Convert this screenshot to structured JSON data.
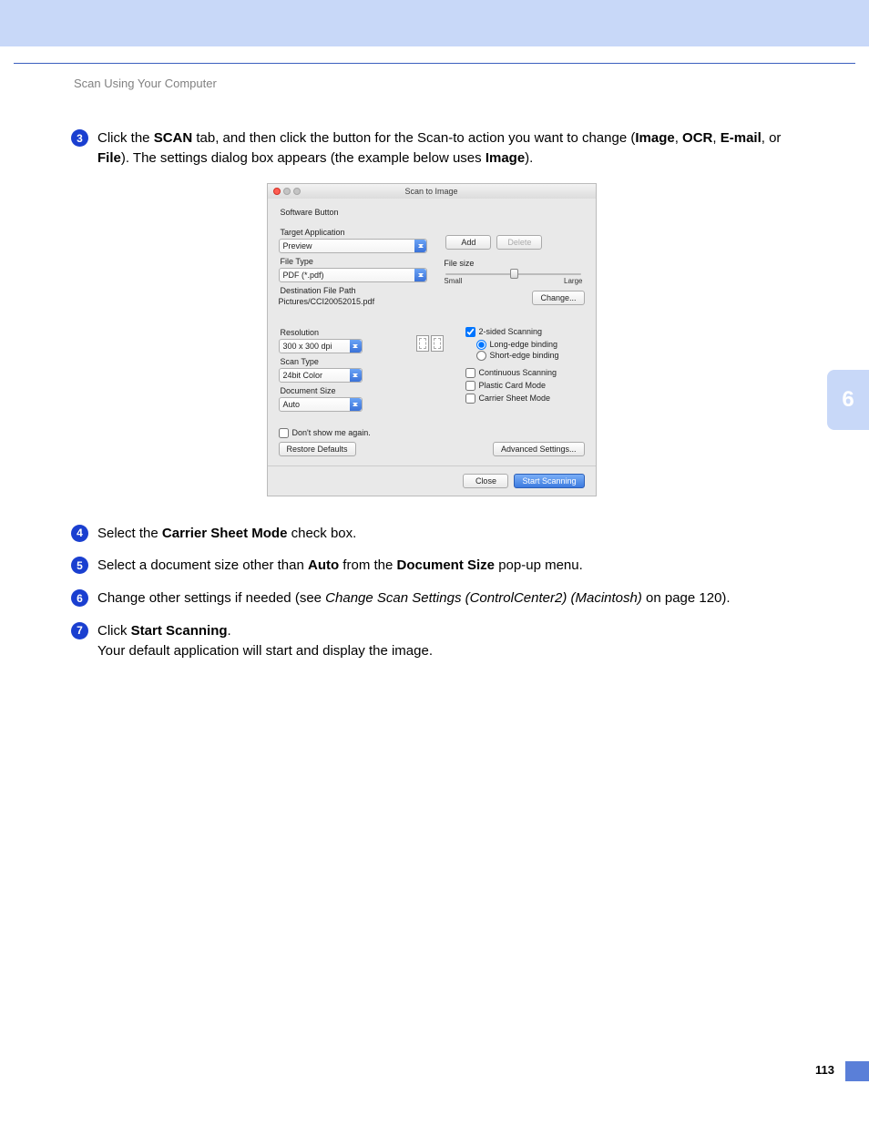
{
  "header": {
    "title": "Scan Using Your Computer"
  },
  "steps": {
    "s3": {
      "num": "3",
      "p1a": "Click the ",
      "scan": "SCAN",
      "p1b": " tab, and then click the button for the Scan-to action you want to change (",
      "image": "Image",
      "c1": ", ",
      "ocr": "OCR",
      "c2": ", ",
      "email": "E-mail",
      "c3": ", or ",
      "file": "File",
      "p1c": "). The settings dialog box appears (the example below uses ",
      "image2": "Image",
      "p1d": ")."
    },
    "s4": {
      "num": "4",
      "a": "Select the ",
      "b": "Carrier Sheet Mode",
      "c": " check box."
    },
    "s5": {
      "num": "5",
      "a": "Select a document size other than ",
      "b": "Auto",
      "c": " from the ",
      "d": "Document Size",
      "e": " pop-up menu."
    },
    "s6": {
      "num": "6",
      "a": "Change other settings if needed (see ",
      "b": "Change Scan Settings (ControlCenter2) (Macintosh)",
      "c": " on page 120)."
    },
    "s7": {
      "num": "7",
      "a": "Click ",
      "b": "Start Scanning",
      "c": ".",
      "d": "Your default application will start and display the image."
    }
  },
  "dlg": {
    "title": "Scan to Image",
    "tab": "Software Button",
    "targetApp": {
      "lbl": "Target Application",
      "val": "Preview"
    },
    "addBtn": "Add",
    "delBtn": "Delete",
    "fileType": {
      "lbl": "File Type",
      "val": "PDF (*.pdf)"
    },
    "fileSize": {
      "lbl": "File size",
      "small": "Small",
      "large": "Large"
    },
    "destPath": {
      "lbl": "Destination File Path",
      "val": "Pictures/CCI20052015.pdf"
    },
    "changeBtn": "Change...",
    "resolution": {
      "lbl": "Resolution",
      "val": "300 x 300 dpi"
    },
    "scanType": {
      "lbl": "Scan Type",
      "val": "24bit Color"
    },
    "docSize": {
      "lbl": "Document Size",
      "val": "Auto"
    },
    "twoSided": "2-sided Scanning",
    "longEdge": "Long-edge binding",
    "shortEdge": "Short-edge binding",
    "continuous": "Continuous Scanning",
    "plastic": "Plastic Card Mode",
    "carrier": "Carrier Sheet Mode",
    "dontShow": "Don't show me again.",
    "restore": "Restore Defaults",
    "advanced": "Advanced Settings...",
    "close": "Close",
    "start": "Start Scanning"
  },
  "chapterTab": "6",
  "pageNum": "113"
}
